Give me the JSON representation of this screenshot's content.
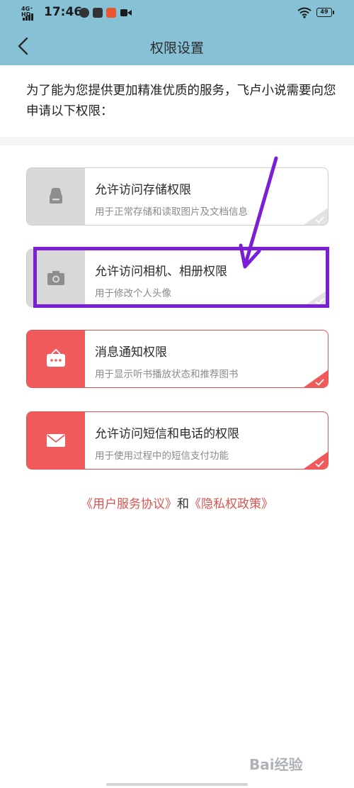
{
  "status_bar": {
    "network": "4G⁺ HD",
    "time": "17:46",
    "battery": "49",
    "app_icons": [
      {
        "name": "circle-icon",
        "glyph": "◎",
        "color": "#333333"
      },
      {
        "name": "search-app-icon",
        "glyph": "搜",
        "color": "#333333"
      },
      {
        "name": "app-icon",
        "glyph": "❂",
        "color": "#e8572f"
      },
      {
        "name": "video-icon",
        "glyph": "▶",
        "color": "#333333"
      }
    ]
  },
  "header": {
    "title": "权限设置"
  },
  "intro": {
    "text": "为了能为您提供更加精准优质的服务，飞卢小说需要向您申请以下权限："
  },
  "permissions": [
    {
      "title": "允许访问存储权限",
      "desc": "用于正常存储和读取图片及文档信息",
      "icon": "storage-icon",
      "active": false
    },
    {
      "title": "允许访问相机、相册权限",
      "desc": "用于修改个人头像",
      "icon": "camera-icon",
      "active": false
    },
    {
      "title": "消息通知权限",
      "desc": "用于显示听书播放状态和推荐图书",
      "icon": "notification-icon",
      "active": true
    },
    {
      "title": "允许访问短信和电话的权限",
      "desc": "用于使用过程中的短信支付功能",
      "icon": "mail-icon",
      "active": true
    }
  ],
  "footer": {
    "link1": "《用户服务协议》",
    "and": "和",
    "link2": "《隐私权政策》"
  },
  "watermark": {
    "text": "Bai经验"
  },
  "colors": {
    "header_bg": "#87c1d6",
    "accent": "#f05a5a",
    "highlight": "#7a1fd6"
  }
}
